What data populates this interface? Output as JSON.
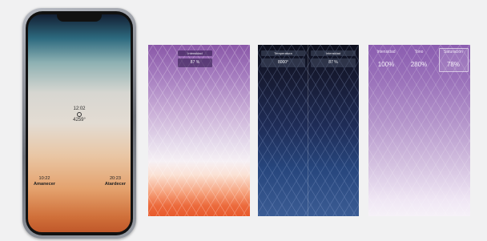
{
  "phone": {
    "time": "12:02",
    "temperature": "4259°",
    "sunrise_time": "10:22",
    "sunrise_label": "Amanecer",
    "sunset_time": "20:23",
    "sunset_label": "Atardecer"
  },
  "panel1": {
    "label": "Intensidad",
    "value": "87 %"
  },
  "panel2": {
    "left": {
      "label": "Temperatura",
      "value": "8000°"
    },
    "right": {
      "label": "Intensidad",
      "value": "87 %"
    }
  },
  "panel3": {
    "items": [
      {
        "label": "Intensidad",
        "value": "100%"
      },
      {
        "label": "Tono",
        "value": "280%"
      },
      {
        "label": "Saturación",
        "value": "78%"
      }
    ]
  }
}
